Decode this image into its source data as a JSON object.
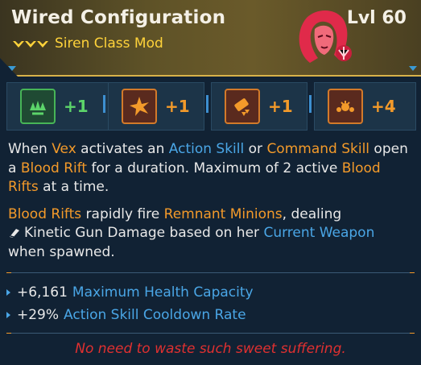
{
  "item": {
    "name": "Wired Configuration",
    "level": "Lvl 60",
    "class_mod": "Siren Class Mod",
    "rarity_color": "#ffd33a",
    "portrait_icon": "siren-vex-portrait-icon"
  },
  "skills": [
    {
      "icon": "green-splash-skill-icon",
      "bonus": "+1",
      "color": "#5cd46a",
      "border": "#47b557",
      "bg": "#1f4a33"
    },
    {
      "icon": "burst-skill-icon",
      "bonus": "+1",
      "color": "#f39a2a",
      "border": "#d37a2a",
      "bg": "#5a2a1e"
    },
    {
      "icon": "weapon-skill-icon",
      "bonus": "+1",
      "color": "#f39a2a",
      "border": "#d37a2a",
      "bg": "#5a2a1e"
    },
    {
      "icon": "minions-skill-icon",
      "bonus": "+4",
      "color": "#f39a2a",
      "border": "#d37a2a",
      "bg": "#5a2a1e"
    }
  ],
  "description": {
    "p1": {
      "t1": "When ",
      "vex": "Vex",
      "t2": " activates an ",
      "action_skill": "Action Skill",
      "t3": " or ",
      "command_skill": "Command Skill",
      "t4": " open a ",
      "blood_rift": "Blood Rift",
      "t5": " for a duration. Maximum of 2 active ",
      "blood_rifts": "Blood Rifts",
      "t6": " at a time."
    },
    "p2": {
      "blood_rifts": "Blood Rifts",
      "t1": " rapidly fire ",
      "remnant_minions": "Remnant Minions",
      "t2": ", dealing",
      "kinetic_icon": "kinetic-damage-icon",
      "kinetic": "Kinetic Gun Damage",
      "t3": " based on her ",
      "current_weapon": "Current Weapon",
      "t4": " when spawned."
    }
  },
  "stats": [
    {
      "value": "+6,161",
      "name": "Maximum Health Capacity"
    },
    {
      "value": "+29%",
      "name": "Action Skill Cooldown Rate"
    }
  ],
  "flavor_text": "No need to waste such sweet suffering.",
  "colors": {
    "keyword_orange": "#f39a2a",
    "keyword_blue": "#4aa6e6",
    "flavor_red": "#e03030"
  }
}
